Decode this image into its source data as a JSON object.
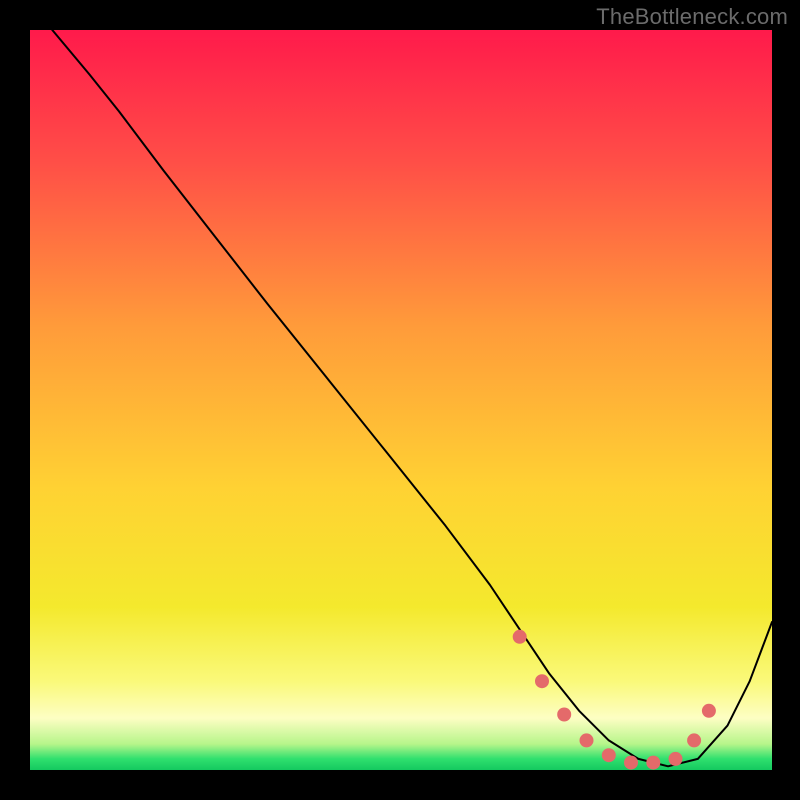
{
  "watermark": "TheBottleneck.com",
  "chart_data": {
    "type": "line",
    "title": "",
    "xlabel": "",
    "ylabel": "",
    "xlim": [
      0,
      100
    ],
    "ylim": [
      0,
      100
    ],
    "grid": false,
    "legend": false,
    "background": {
      "type": "vertical-gradient",
      "stops": [
        {
          "offset": 0.0,
          "color": "#ff1a4b"
        },
        {
          "offset": 0.18,
          "color": "#ff4f47"
        },
        {
          "offset": 0.4,
          "color": "#ff9b3a"
        },
        {
          "offset": 0.62,
          "color": "#ffd233"
        },
        {
          "offset": 0.78,
          "color": "#f4e92d"
        },
        {
          "offset": 0.88,
          "color": "#faf97a"
        },
        {
          "offset": 0.93,
          "color": "#fdfec3"
        },
        {
          "offset": 0.965,
          "color": "#b6f58a"
        },
        {
          "offset": 0.985,
          "color": "#2fe06e"
        },
        {
          "offset": 1.0,
          "color": "#14c95f"
        }
      ]
    },
    "series": [
      {
        "name": "bottleneck-curve",
        "color": "#000000",
        "stroke_width": 2,
        "x": [
          3,
          8,
          12,
          18,
          25,
          32,
          40,
          48,
          56,
          62,
          66,
          70,
          74,
          78,
          82,
          86,
          90,
          94,
          97,
          100
        ],
        "y": [
          100,
          94,
          89,
          81,
          72,
          63,
          53,
          43,
          33,
          25,
          19,
          13,
          8,
          4,
          1.5,
          0.5,
          1.5,
          6,
          12,
          20
        ]
      }
    ],
    "markers": {
      "name": "optimal-zone",
      "color": "#e46a6a",
      "radius": 7,
      "x": [
        66,
        69,
        72,
        75,
        78,
        81,
        84,
        87,
        89.5,
        91.5
      ],
      "y": [
        18,
        12,
        7.5,
        4,
        2,
        1,
        1,
        1.5,
        4,
        8
      ]
    }
  }
}
